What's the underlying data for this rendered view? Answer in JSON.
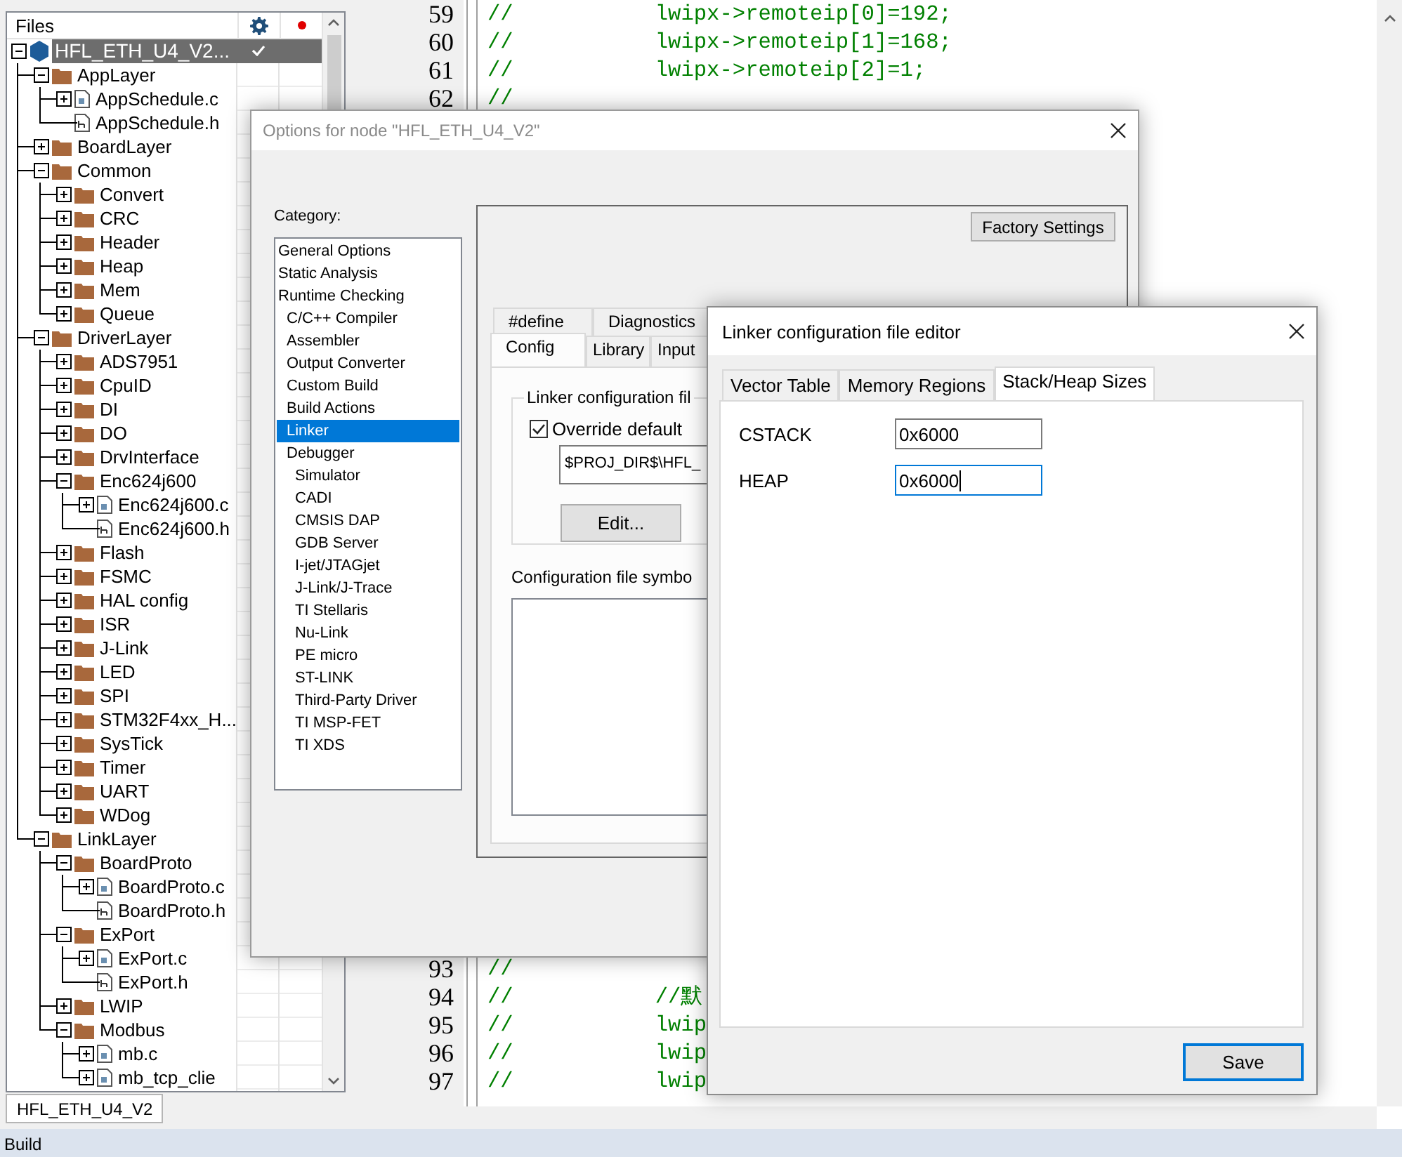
{
  "files_panel": {
    "header": "Files",
    "tree": [
      {
        "label": "HFL_ETH_U4_V2...",
        "kind": "project",
        "expanded": true,
        "selected": true,
        "checked": true,
        "children": [
          {
            "label": "AppLayer",
            "kind": "folder",
            "expanded": true,
            "selected": false,
            "children": [
              {
                "label": "AppSchedule.c",
                "kind": "c-file",
                "expanded": false,
                "selected": false
              },
              {
                "label": "AppSchedule.h",
                "kind": "h-file",
                "selected": false
              }
            ]
          },
          {
            "label": "BoardLayer",
            "kind": "folder",
            "expanded": false,
            "selected": false
          },
          {
            "label": "Common",
            "kind": "folder",
            "expanded": true,
            "selected": false,
            "children": [
              {
                "label": "Convert",
                "kind": "folder",
                "expanded": false,
                "selected": false
              },
              {
                "label": "CRC",
                "kind": "folder",
                "expanded": false,
                "selected": false
              },
              {
                "label": "Header",
                "kind": "folder",
                "expanded": false,
                "selected": false
              },
              {
                "label": "Heap",
                "kind": "folder",
                "expanded": false,
                "selected": false
              },
              {
                "label": "Mem",
                "kind": "folder",
                "expanded": false,
                "selected": false
              },
              {
                "label": "Queue",
                "kind": "folder",
                "expanded": false,
                "selected": false
              }
            ]
          },
          {
            "label": "DriverLayer",
            "kind": "folder",
            "expanded": true,
            "selected": false,
            "children": [
              {
                "label": "ADS7951",
                "kind": "folder",
                "expanded": false,
                "selected": false
              },
              {
                "label": "CpuID",
                "kind": "folder",
                "expanded": false,
                "selected": false
              },
              {
                "label": "DI",
                "kind": "folder",
                "expanded": false,
                "selected": false
              },
              {
                "label": "DO",
                "kind": "folder",
                "expanded": false,
                "selected": false
              },
              {
                "label": "DrvInterface",
                "kind": "folder",
                "expanded": false,
                "selected": false
              },
              {
                "label": "Enc624j600",
                "kind": "folder",
                "expanded": true,
                "selected": false,
                "children": [
                  {
                    "label": "Enc624j600.c",
                    "kind": "c-file",
                    "expanded": false,
                    "selected": false
                  },
                  {
                    "label": "Enc624j600.h",
                    "kind": "h-file",
                    "selected": false
                  }
                ]
              },
              {
                "label": "Flash",
                "kind": "folder",
                "expanded": false,
                "selected": false
              },
              {
                "label": "FSMC",
                "kind": "folder",
                "expanded": false,
                "selected": false
              },
              {
                "label": "HAL config",
                "kind": "folder",
                "expanded": false,
                "selected": false
              },
              {
                "label": "ISR",
                "kind": "folder",
                "expanded": false,
                "selected": false
              },
              {
                "label": "J-Link",
                "kind": "folder",
                "expanded": false,
                "selected": false
              },
              {
                "label": "LED",
                "kind": "folder",
                "expanded": false,
                "selected": false
              },
              {
                "label": "SPI",
                "kind": "folder",
                "expanded": false,
                "selected": false
              },
              {
                "label": "STM32F4xx_H...",
                "kind": "folder",
                "expanded": false,
                "selected": false
              },
              {
                "label": "SysTick",
                "kind": "folder",
                "expanded": false,
                "selected": false
              },
              {
                "label": "Timer",
                "kind": "folder",
                "expanded": false,
                "selected": false
              },
              {
                "label": "UART",
                "kind": "folder",
                "expanded": false,
                "selected": false
              },
              {
                "label": "WDog",
                "kind": "folder",
                "expanded": false,
                "selected": false
              }
            ]
          },
          {
            "label": "LinkLayer",
            "kind": "folder",
            "expanded": true,
            "selected": false,
            "children": [
              {
                "label": "BoardProto",
                "kind": "folder",
                "expanded": true,
                "selected": false,
                "children": [
                  {
                    "label": "BoardProto.c",
                    "kind": "c-file",
                    "expanded": false,
                    "selected": false
                  },
                  {
                    "label": "BoardProto.h",
                    "kind": "h-file",
                    "selected": false
                  }
                ]
              },
              {
                "label": "ExPort",
                "kind": "folder",
                "expanded": true,
                "selected": false,
                "children": [
                  {
                    "label": "ExPort.c",
                    "kind": "c-file",
                    "expanded": false,
                    "selected": false
                  },
                  {
                    "label": "ExPort.h",
                    "kind": "h-file",
                    "selected": false
                  }
                ]
              },
              {
                "label": "LWIP",
                "kind": "folder",
                "expanded": false,
                "selected": false
              },
              {
                "label": "Modbus",
                "kind": "folder",
                "expanded": true,
                "selected": false,
                "children": [
                  {
                    "label": "mb.c",
                    "kind": "c-file",
                    "expanded": false,
                    "selected": false
                  },
                  {
                    "label": "mb_tcp_clie",
                    "kind": "c-file",
                    "expanded": false,
                    "selected": false
                  }
                ]
              }
            ]
          }
        ]
      }
    ],
    "workspace_tab": "HFL_ETH_U4_V2"
  },
  "editor": {
    "lines_top": [
      {
        "number": "59",
        "code": "//           lwipx->remoteip[0]=192;"
      },
      {
        "number": "60",
        "code": "//           lwipx->remoteip[1]=168;"
      },
      {
        "number": "61",
        "code": "//           lwipx->remoteip[2]=1;"
      },
      {
        "number": "62",
        "code": "//"
      }
    ],
    "lines_bottom": [
      {
        "number": "93",
        "code": "//"
      },
      {
        "number": "94",
        "code": "//           //默"
      },
      {
        "number": "95",
        "code": "//           lwip"
      },
      {
        "number": "96",
        "code": "//           lwip"
      },
      {
        "number": "97",
        "code": "//           lwip"
      }
    ]
  },
  "options_dialog": {
    "title": "Options for node \"HFL_ETH_U4_V2\"",
    "category_label": "Category:",
    "categories": [
      {
        "label": "General Options",
        "selected": false
      },
      {
        "label": "Static Analysis",
        "selected": false
      },
      {
        "label": "Runtime Checking",
        "selected": false,
        "children": [
          {
            "label": "C/C++ Compiler",
            "selected": false
          },
          {
            "label": "Assembler",
            "selected": false
          },
          {
            "label": "Output Converter",
            "selected": false
          },
          {
            "label": "Custom Build",
            "selected": false
          },
          {
            "label": "Build Actions",
            "selected": false
          },
          {
            "label": "Linker",
            "selected": true
          },
          {
            "label": "Debugger",
            "selected": false,
            "children": [
              {
                "label": "Simulator",
                "selected": false
              },
              {
                "label": "CADI",
                "selected": false
              },
              {
                "label": "CMSIS DAP",
                "selected": false
              },
              {
                "label": "GDB Server",
                "selected": false
              },
              {
                "label": "I-jet/JTAGjet",
                "selected": false
              },
              {
                "label": "J-Link/J-Trace",
                "selected": false
              },
              {
                "label": "TI Stellaris",
                "selected": false
              },
              {
                "label": "Nu-Link",
                "selected": false
              },
              {
                "label": "PE micro",
                "selected": false
              },
              {
                "label": "ST-LINK",
                "selected": false
              },
              {
                "label": "Third-Party Driver",
                "selected": false
              },
              {
                "label": "TI MSP-FET",
                "selected": false
              },
              {
                "label": "TI XDS",
                "selected": false
              }
            ]
          }
        ]
      }
    ],
    "factory_button": "Factory Settings",
    "tabs_back": [
      {
        "label": "#define",
        "selected": false
      },
      {
        "label": "Diagnostics",
        "selected": false
      }
    ],
    "tabs_front": [
      {
        "label": "Config",
        "selected": true
      },
      {
        "label": "Library",
        "selected": false
      },
      {
        "label": "Input",
        "selected": false
      }
    ],
    "group_title": "Linker configuration fil",
    "override": {
      "label": "Override default",
      "checked": true
    },
    "path_value": "$PROJ_DIR$\\HFL_",
    "edit_button": "Edit...",
    "symbols_label": "Configuration file symbo"
  },
  "linker_dialog": {
    "title": "Linker configuration file editor",
    "tabs": [
      {
        "label": "Vector Table",
        "selected": false
      },
      {
        "label": "Memory Regions",
        "selected": false
      },
      {
        "label": "Stack/Heap Sizes",
        "selected": true
      }
    ],
    "fields": [
      {
        "label": "CSTACK",
        "value": "0x6000",
        "focused": false
      },
      {
        "label": "HEAP",
        "value": "0x6000",
        "focused": true
      }
    ],
    "save_button": "Save"
  },
  "status_bar": {
    "label": "Build"
  }
}
